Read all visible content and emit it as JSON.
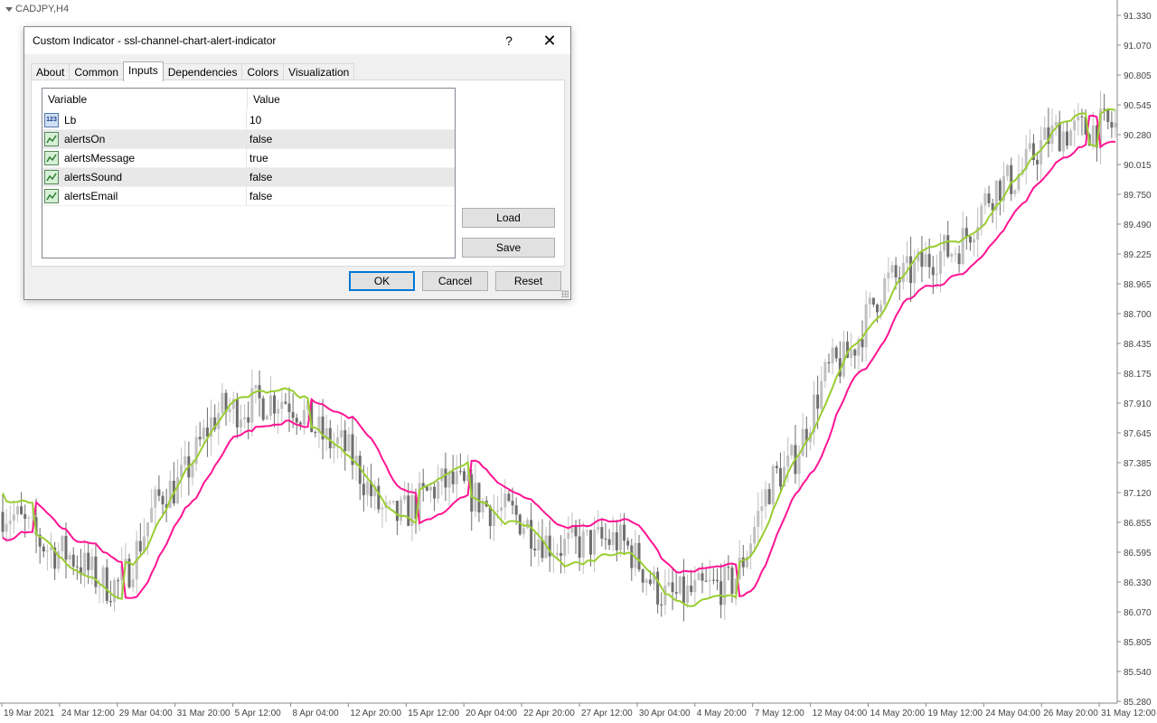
{
  "chart": {
    "symbol": "CADJPY,H4",
    "price_labels": [
      "91.330",
      "91.070",
      "90.805",
      "90.545",
      "90.280",
      "90.015",
      "89.750",
      "89.490",
      "89.225",
      "88.965",
      "88.700",
      "88.435",
      "88.175",
      "87.910",
      "87.645",
      "87.385",
      "87.120",
      "86.855",
      "86.595",
      "86.330",
      "86.070",
      "85.805",
      "85.540",
      "85.280"
    ],
    "time_labels": [
      "19 Mar 2021",
      "24 Mar 12:00",
      "29 Mar 04:00",
      "31 Mar 20:00",
      "5 Apr 12:00",
      "8 Apr 04:00",
      "12 Apr 20:00",
      "15 Apr 12:00",
      "20 Apr 04:00",
      "22 Apr 20:00",
      "27 Apr 12:00",
      "30 Apr 04:00",
      "4 May 20:00",
      "7 May 12:00",
      "12 May 04:00",
      "14 May 20:00",
      "19 May 12:00",
      "24 May 04:00",
      "26 May 20:00",
      "31 May 12:00"
    ],
    "colors": {
      "ssl_up": "#9acd32",
      "ssl_down": "#ff1493",
      "candle_up": "#c0c0c0",
      "candle_down": "#6e6e6e",
      "axis": "#888888"
    }
  },
  "chart_data": {
    "type": "line",
    "title": "CADJPY,H4",
    "ylim": [
      85.28,
      91.33
    ],
    "series": [],
    "x": [
      0,
      5,
      10,
      15,
      20,
      25,
      30,
      35,
      40,
      45,
      50,
      55,
      60,
      65,
      70,
      75,
      80,
      85,
      90,
      95,
      100
    ],
    "close": [
      86.95,
      86.6,
      86.3,
      87.15,
      87.85,
      87.95,
      87.55,
      86.9,
      87.2,
      86.95,
      86.65,
      86.7,
      86.2,
      86.3,
      87.3,
      88.25,
      89.0,
      89.25,
      89.85,
      90.3,
      90.35
    ]
  },
  "dialog": {
    "title": "Custom Indicator - ssl-channel-chart-alert-indicator",
    "help_glyph": "?",
    "close_glyph": "✕",
    "tabs": [
      "About",
      "Common",
      "Inputs",
      "Dependencies",
      "Colors",
      "Visualization"
    ],
    "active_tab": "Inputs",
    "columns": {
      "variable": "Variable",
      "value": "Value"
    },
    "rows": [
      {
        "variable": "Lb",
        "value": "10",
        "icon": "number-icon"
      },
      {
        "variable": "alertsOn",
        "value": "false",
        "icon": "bool-icon"
      },
      {
        "variable": "alertsMessage",
        "value": "true",
        "icon": "bool-icon"
      },
      {
        "variable": "alertsSound",
        "value": "false",
        "icon": "bool-icon"
      },
      {
        "variable": "alertsEmail",
        "value": "false",
        "icon": "bool-icon"
      }
    ],
    "number_icon_text": "123",
    "load_label": "Load",
    "save_label": "Save",
    "ok_label": "OK",
    "cancel_label": "Cancel",
    "reset_label": "Reset"
  }
}
